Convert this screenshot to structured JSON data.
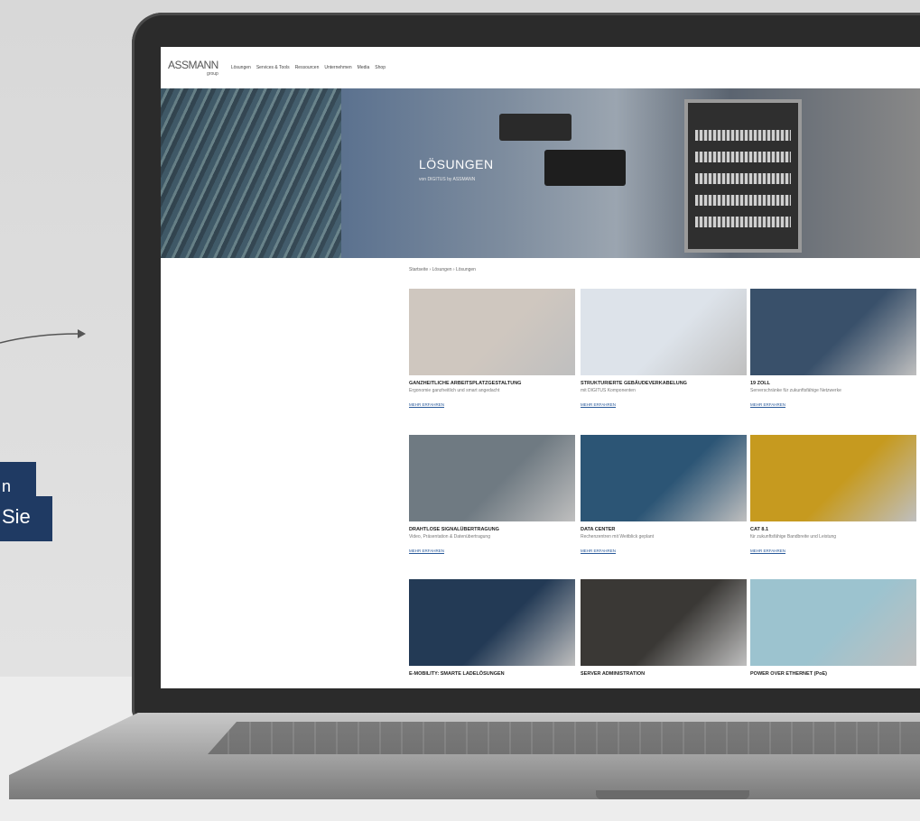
{
  "callout": {
    "line1": "n",
    "line2": "Sie"
  },
  "site": {
    "logo": "ASSMANN",
    "logo_sub": "group",
    "menu": [
      "Lösungen",
      "Services & Tools",
      "Ressourcen",
      "Unternehmen",
      "Media",
      "Shop"
    ],
    "hero_title": "LÖSUNGEN",
    "hero_sub": "von DIGITUS by ASSMANN",
    "breadcrumb": "Startseite › Lösungen › Lösungen",
    "more_label": "MEHR ERFAHREN",
    "cards": [
      {
        "title": "GANZHEITLICHE ARBEITSPLATZGESTALTUNG",
        "desc": "Ergonomie ganzheitlich und smart angedacht",
        "color": "#cfc7bf"
      },
      {
        "title": "STRUKTURIERTE GEBÄUDEVERKABELUNG",
        "desc": "mit DIGITUS Komponenten",
        "color": "#dde3ea"
      },
      {
        "title": "19 ZOLL",
        "desc": "Serverschränke für zukunftsfähige Netzwerke",
        "color": "#39506a"
      },
      {
        "title": "DRAHTLOSE SIGNALÜBERTRAGUNG",
        "desc": "Video, Präsentation & Datenübertragung",
        "color": "#6f7a82"
      },
      {
        "title": "DATA CENTER",
        "desc": "Rechenzentren mit Weitblick geplant",
        "color": "#2c5575"
      },
      {
        "title": "CAT 8.1",
        "desc": "für zukunftsfähige Bandbreite und Leistung",
        "color": "#c69a1f"
      },
      {
        "title": "E-MOBILITY: SMARTE LADELÖSUNGEN",
        "desc": "",
        "color": "#233a55"
      },
      {
        "title": "SERVER ADMINISTRATION",
        "desc": "",
        "color": "#3a3835"
      },
      {
        "title": "POWER OVER ETHERNET (PoE)",
        "desc": "",
        "color": "#9cc3cf"
      }
    ]
  }
}
